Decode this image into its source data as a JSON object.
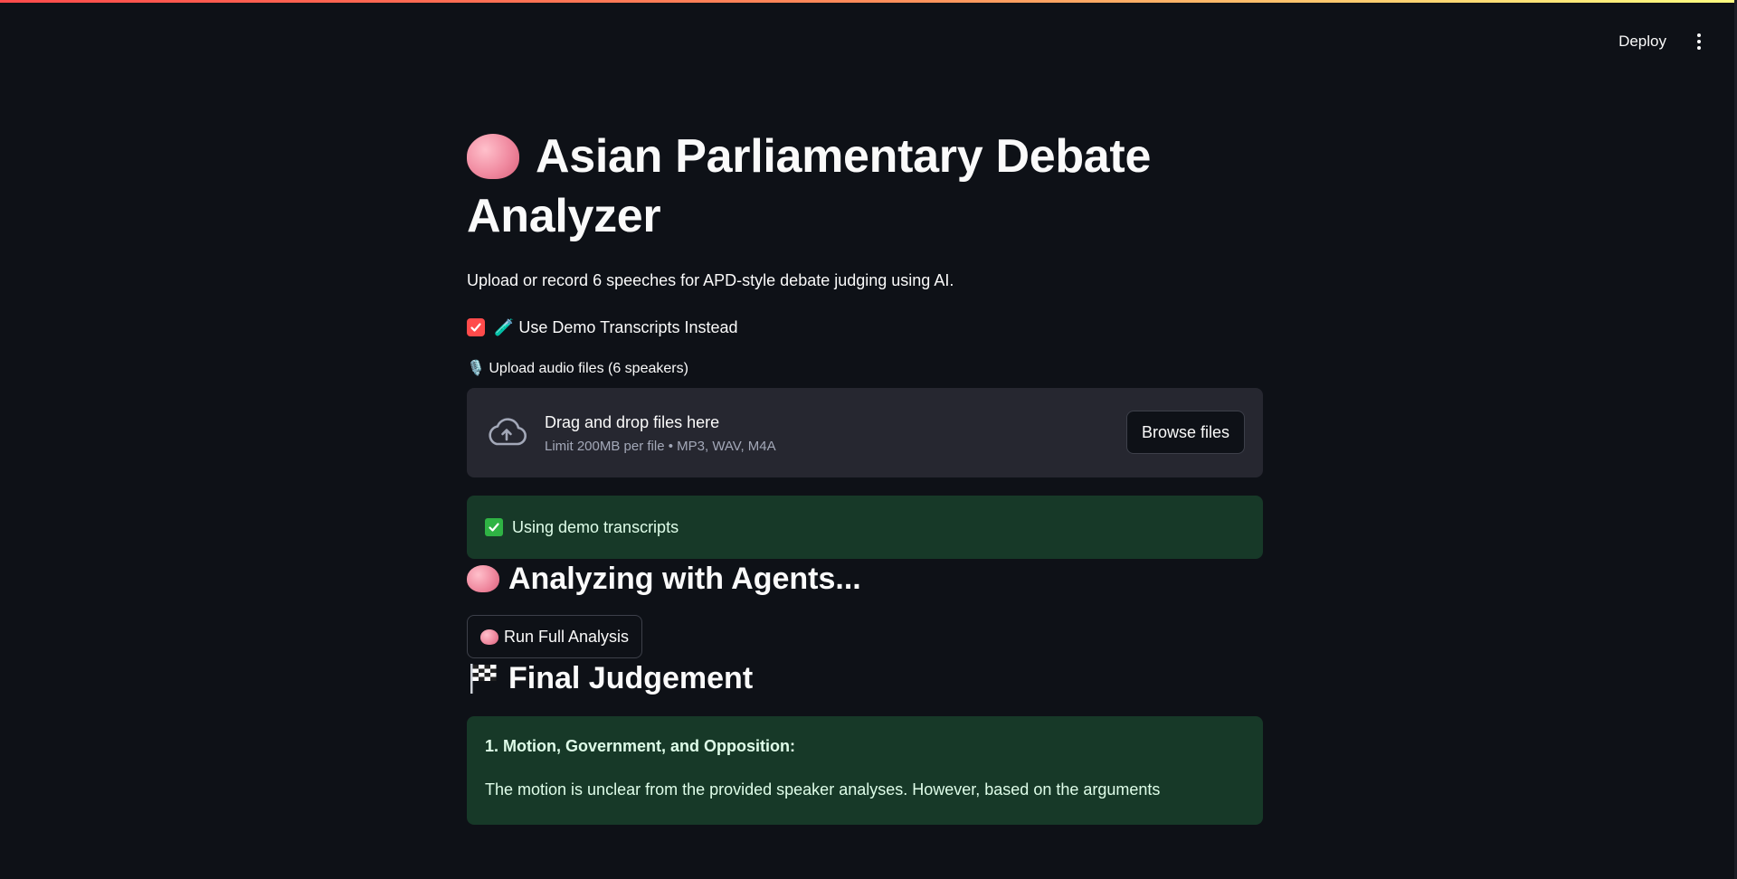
{
  "header": {
    "deploy_label": "Deploy"
  },
  "app": {
    "title_line1": "Asian Parliamentary Debate",
    "title_line2": "Analyzer",
    "subtitle": "Upload or record 6 speeches for APD-style debate judging using AI."
  },
  "demo_toggle": {
    "checked": true,
    "label": "🧪 Use Demo Transcripts Instead"
  },
  "uploader": {
    "label": "🎙️ Upload audio files (6 speakers)",
    "drop_text": "Drag and drop files here",
    "limit_text": "Limit 200MB per file • MP3, WAV, M4A",
    "browse_label": "Browse files"
  },
  "status": {
    "message": "Using demo transcripts"
  },
  "analysis": {
    "heading": "Analyzing with Agents...",
    "run_button_label": "Run Full Analysis"
  },
  "judgement": {
    "heading": "Final Judgement",
    "section_title": "1. Motion, Government, and Opposition:",
    "text": "The motion is unclear from the provided speaker analyses. However, based on the arguments"
  },
  "colors": {
    "background": "#0e1117",
    "accent": "#ff4b4b",
    "success_bg": "#173928",
    "dropzone_bg": "#262730"
  }
}
